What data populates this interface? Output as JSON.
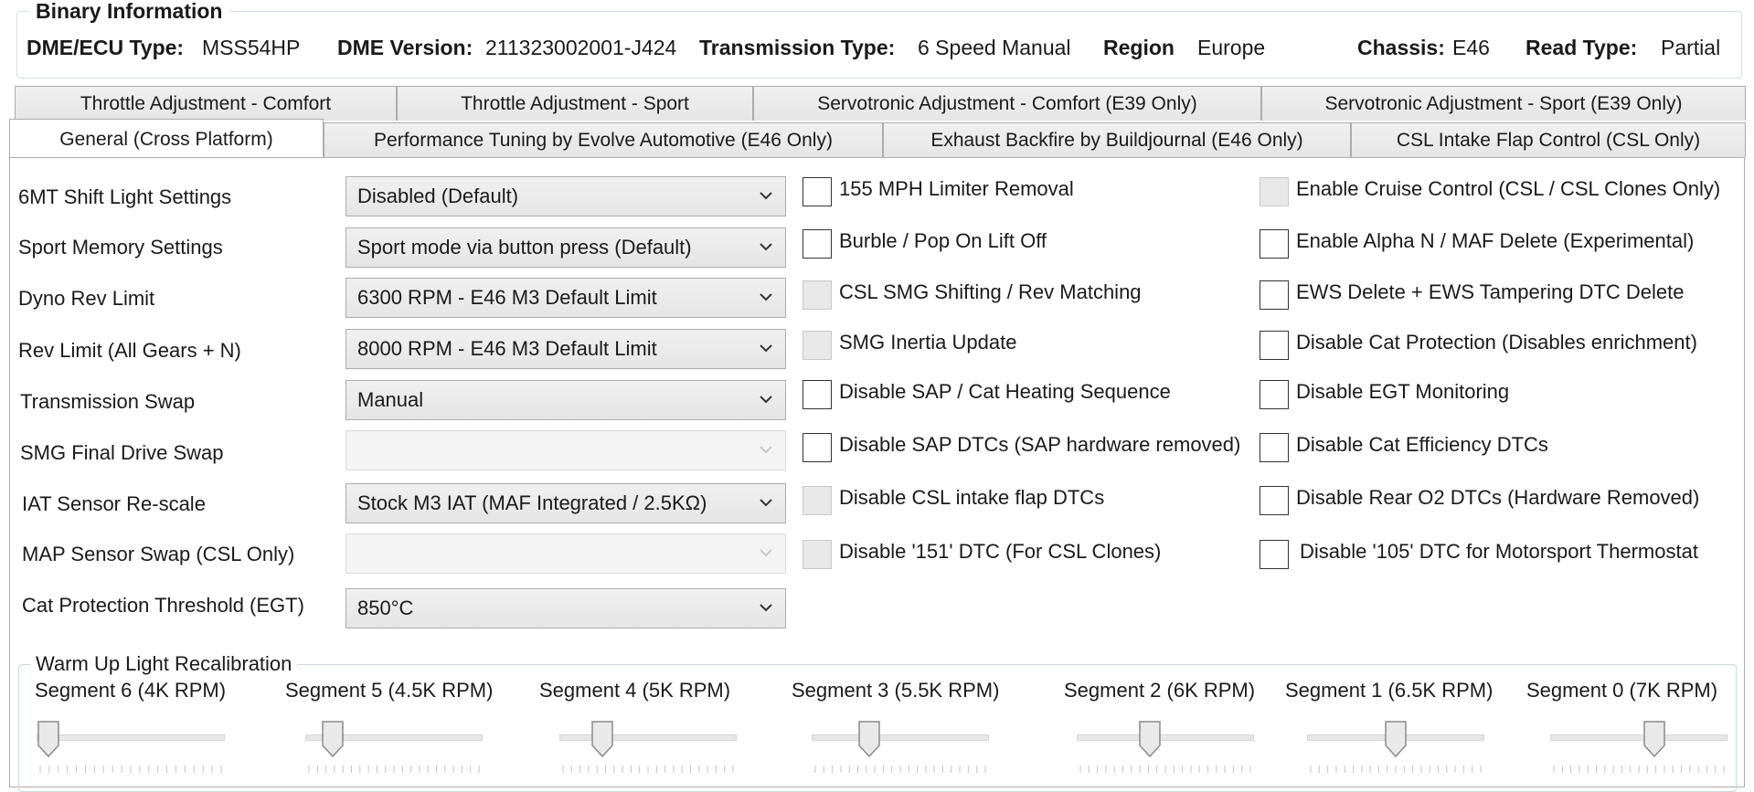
{
  "binary_info": {
    "title": "Binary Information",
    "fields": [
      {
        "label": "DME/ECU Type:",
        "value": "MSS54HP"
      },
      {
        "label": "DME Version:",
        "value": "211323002001-J424"
      },
      {
        "label": "Transmission Type:",
        "value": "6 Speed Manual"
      },
      {
        "label": "Region",
        "value": "Europe"
      },
      {
        "label": "Chassis:",
        "value": "E46"
      },
      {
        "label": "Read Type:",
        "value": "Partial"
      }
    ]
  },
  "tabs_row1": [
    {
      "label": "Throttle Adjustment - Comfort"
    },
    {
      "label": "Throttle Adjustment - Sport"
    },
    {
      "label": "Servotronic Adjustment - Comfort (E39 Only)"
    },
    {
      "label": "Servotronic Adjustment - Sport (E39 Only)"
    }
  ],
  "tabs_row2": [
    {
      "label": "General (Cross Platform)",
      "active": true
    },
    {
      "label": "Performance Tuning by Evolve Automotive (E46 Only)"
    },
    {
      "label": "Exhaust Backfire by Buildjournal (E46 Only)"
    },
    {
      "label": "CSL Intake Flap Control (CSL Only)"
    }
  ],
  "settings": [
    {
      "label": "6MT Shift Light Settings",
      "value": "Disabled (Default)",
      "enabled": true
    },
    {
      "label": "Sport Memory Settings",
      "value": "Sport mode via button press (Default)",
      "enabled": true
    },
    {
      "label": "Dyno Rev Limit",
      "value": "6300 RPM - E46 M3 Default Limit",
      "enabled": true
    },
    {
      "label": "Rev Limit (All Gears + N)",
      "value": "8000 RPM - E46 M3 Default Limit",
      "enabled": true
    },
    {
      "label": "Transmission Swap",
      "value": "Manual",
      "enabled": true
    },
    {
      "label": "SMG Final Drive Swap",
      "value": "",
      "enabled": false
    },
    {
      "label": "IAT Sensor Re-scale",
      "value": "Stock M3 IAT (MAF Integrated / 2.5KΩ)",
      "enabled": true
    },
    {
      "label": "MAP Sensor Swap (CSL Only)",
      "value": "",
      "enabled": false
    },
    {
      "label": "Cat Protection Threshold (EGT)",
      "value": "850°C",
      "enabled": true
    }
  ],
  "checkboxes_col1": [
    {
      "label": "155 MPH Limiter Removal",
      "enabled": true,
      "checked": false
    },
    {
      "label": "Burble / Pop On Lift Off",
      "enabled": true,
      "checked": false
    },
    {
      "label": "CSL SMG Shifting / Rev Matching",
      "enabled": false,
      "checked": false
    },
    {
      "label": "SMG Inertia Update",
      "enabled": false,
      "checked": false
    },
    {
      "label": "Disable SAP / Cat Heating Sequence",
      "enabled": true,
      "checked": false
    },
    {
      "label": "Disable SAP DTCs (SAP hardware removed)",
      "enabled": true,
      "checked": false
    },
    {
      "label": "Disable CSL intake flap DTCs",
      "enabled": false,
      "checked": false
    },
    {
      "label": "Disable '151' DTC (For CSL Clones)",
      "enabled": false,
      "checked": false
    }
  ],
  "checkboxes_col2": [
    {
      "label": "Enable Cruise Control (CSL / CSL Clones Only)",
      "enabled": false,
      "checked": false
    },
    {
      "label": "Enable Alpha N / MAF Delete (Experimental)",
      "enabled": true,
      "checked": false
    },
    {
      "label": "EWS Delete + EWS Tampering DTC Delete",
      "enabled": true,
      "checked": false
    },
    {
      "label": "Disable Cat Protection (Disables enrichment)",
      "enabled": true,
      "checked": false
    },
    {
      "label": "Disable EGT Monitoring",
      "enabled": true,
      "checked": false
    },
    {
      "label": "Disable Cat Efficiency DTCs",
      "enabled": true,
      "checked": false
    },
    {
      "label": "Disable Rear O2 DTCs (Hardware Removed)",
      "enabled": true,
      "checked": false
    },
    {
      "label": "Disable '105' DTC for Motorsport Thermostat",
      "enabled": true,
      "checked": false
    }
  ],
  "warm_up": {
    "title": "Warm Up Light Recalibration",
    "segments": [
      {
        "label": "Segment 6 (4K RPM)",
        "position": 0.0
      },
      {
        "label": "Segment 5 (4.5K RPM)",
        "position": 0.1
      },
      {
        "label": "Segment 4 (5K RPM)",
        "position": 0.2
      },
      {
        "label": "Segment 3 (5.5K RPM)",
        "position": 0.3
      },
      {
        "label": "Segment 2 (6K RPM)",
        "position": 0.4
      },
      {
        "label": "Segment 1 (6.5K RPM)",
        "position": 0.5
      },
      {
        "label": "Segment 0 (7K RPM)",
        "position": 0.6
      }
    ]
  },
  "icons": {
    "dropdown": "chevron-down-icon",
    "slider_thumb": "slider-thumb-icon"
  }
}
